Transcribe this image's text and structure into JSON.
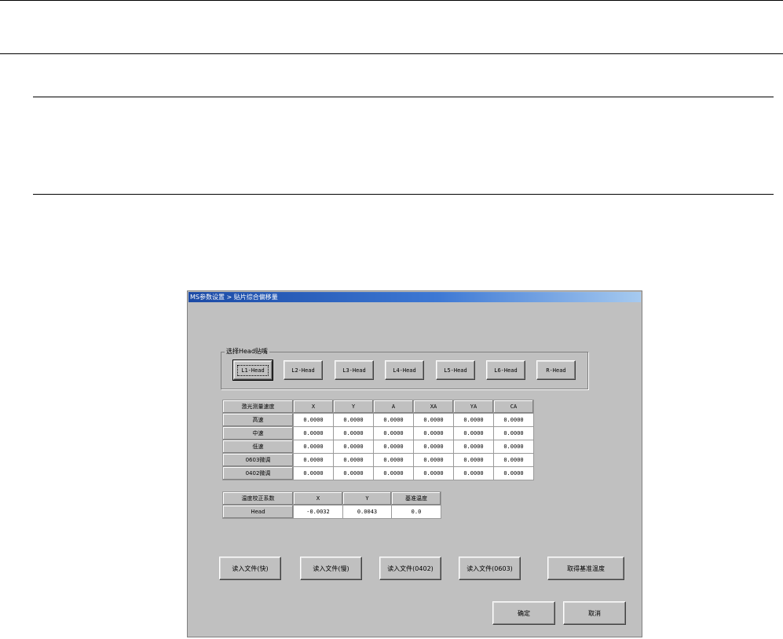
{
  "dialog": {
    "title": "MS参数设置 > 贴片综合偏移量",
    "group_label": "选择Head贴嘴",
    "heads": [
      "L1-Head",
      "L2-Head",
      "L3-Head",
      "L4-Head",
      "L5-Head",
      "L6-Head",
      "R-Head"
    ],
    "table1": {
      "corner": "激光测量速度",
      "columns": [
        "X",
        "Y",
        "A",
        "XA",
        "YA",
        "CA"
      ],
      "rows": [
        {
          "label": "高速",
          "values": [
            "0.0000",
            "0.0000",
            "0.0000",
            "0.0000",
            "0.0000",
            "0.0000"
          ]
        },
        {
          "label": "中速",
          "values": [
            "0.0000",
            "0.0000",
            "0.0000",
            "0.0000",
            "0.0000",
            "0.0000"
          ]
        },
        {
          "label": "低速",
          "values": [
            "0.0000",
            "0.0000",
            "0.0000",
            "0.0000",
            "0.0000",
            "0.0000"
          ]
        },
        {
          "label": "0603微调",
          "values": [
            "0.0000",
            "0.0000",
            "0.0000",
            "0.0000",
            "0.0000",
            "0.0000"
          ]
        },
        {
          "label": "0402微调",
          "values": [
            "0.0000",
            "0.0000",
            "0.0000",
            "0.0000",
            "0.0000",
            "0.0000"
          ]
        }
      ]
    },
    "table2": {
      "corner": "温度校正系数",
      "columns": [
        "X",
        "Y",
        "基准温度"
      ],
      "rows": [
        {
          "label": "Head",
          "values": [
            "-0.0032",
            "0.0043",
            "0.0"
          ]
        }
      ]
    },
    "file_buttons": [
      "读入文件(快)",
      "读入文件(慢)",
      "读入文件(0402)",
      "读入文件(0603)",
      "取得基准温度"
    ],
    "ok_label": "确定",
    "cancel_label": "取消"
  }
}
